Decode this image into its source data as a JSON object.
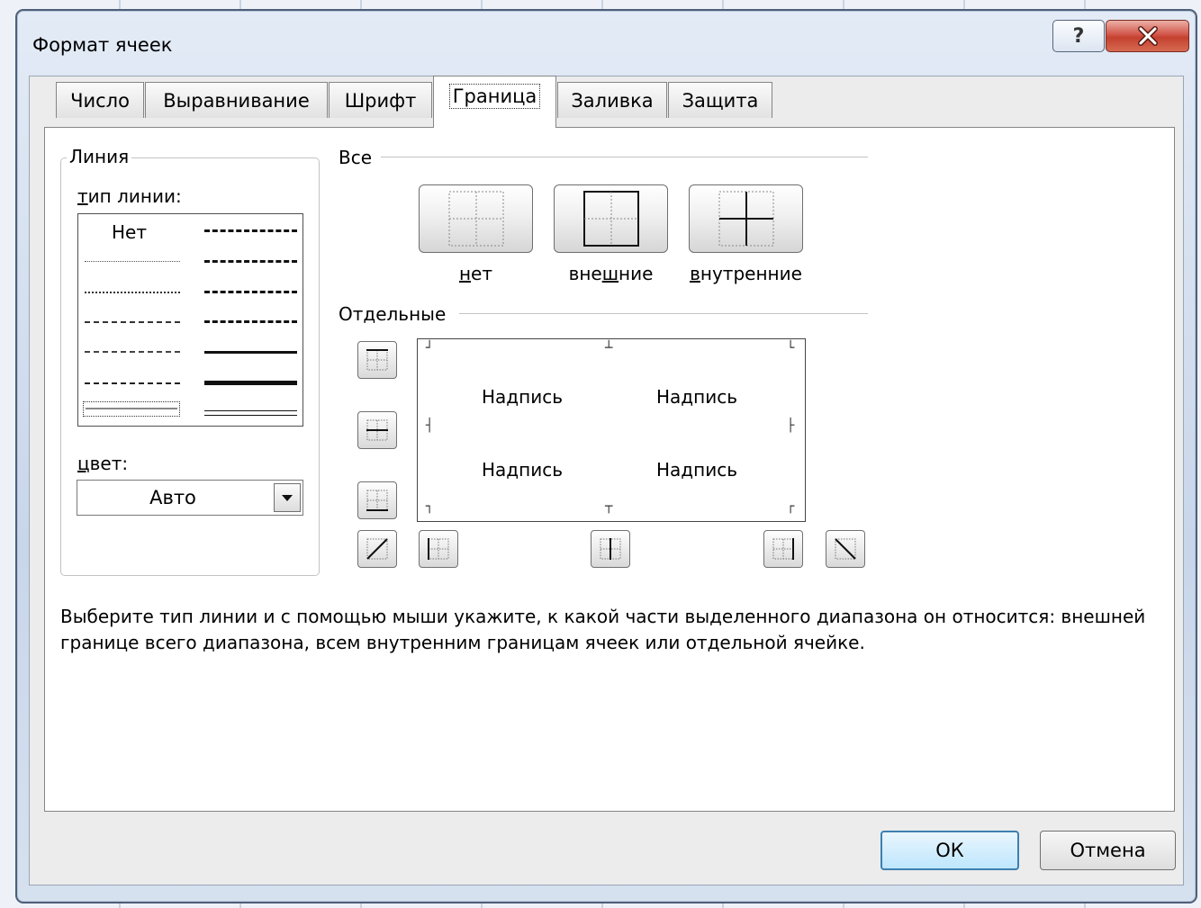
{
  "dialog": {
    "title": "Формат ячеек",
    "help_label": "?"
  },
  "tabs": [
    {
      "label": "Число"
    },
    {
      "label": "Выравнивание"
    },
    {
      "label": "Шрифт"
    },
    {
      "label": "Граница",
      "active": true
    },
    {
      "label": "Заливка"
    },
    {
      "label": "Защита"
    }
  ],
  "line_group": {
    "title": "Линия",
    "style_label_first": "т",
    "style_label_rest": "ип линии:",
    "none_label": "Нет",
    "color_label_first": "ц",
    "color_label_rest": "вет:",
    "color_value": "Авто"
  },
  "presets": {
    "title": "Все",
    "none_first": "н",
    "none_rest": "ет",
    "outline_pre": "вне",
    "outline_u": "ш",
    "outline_post": "ние",
    "inside_first": "в",
    "inside_rest": "нутренние"
  },
  "border": {
    "title": "Отдельные",
    "preview_text": [
      "Надпись",
      "Надпись",
      "Надпись",
      "Надпись"
    ]
  },
  "description": "Выберите тип линии и с помощью мыши укажите, к какой части выделенного диапазона он относится: внешней границе всего диапазона, всем внутренним границам ячеек или отдельной ячейке.",
  "buttons": {
    "ok": "ОК",
    "cancel": "Отмена"
  }
}
